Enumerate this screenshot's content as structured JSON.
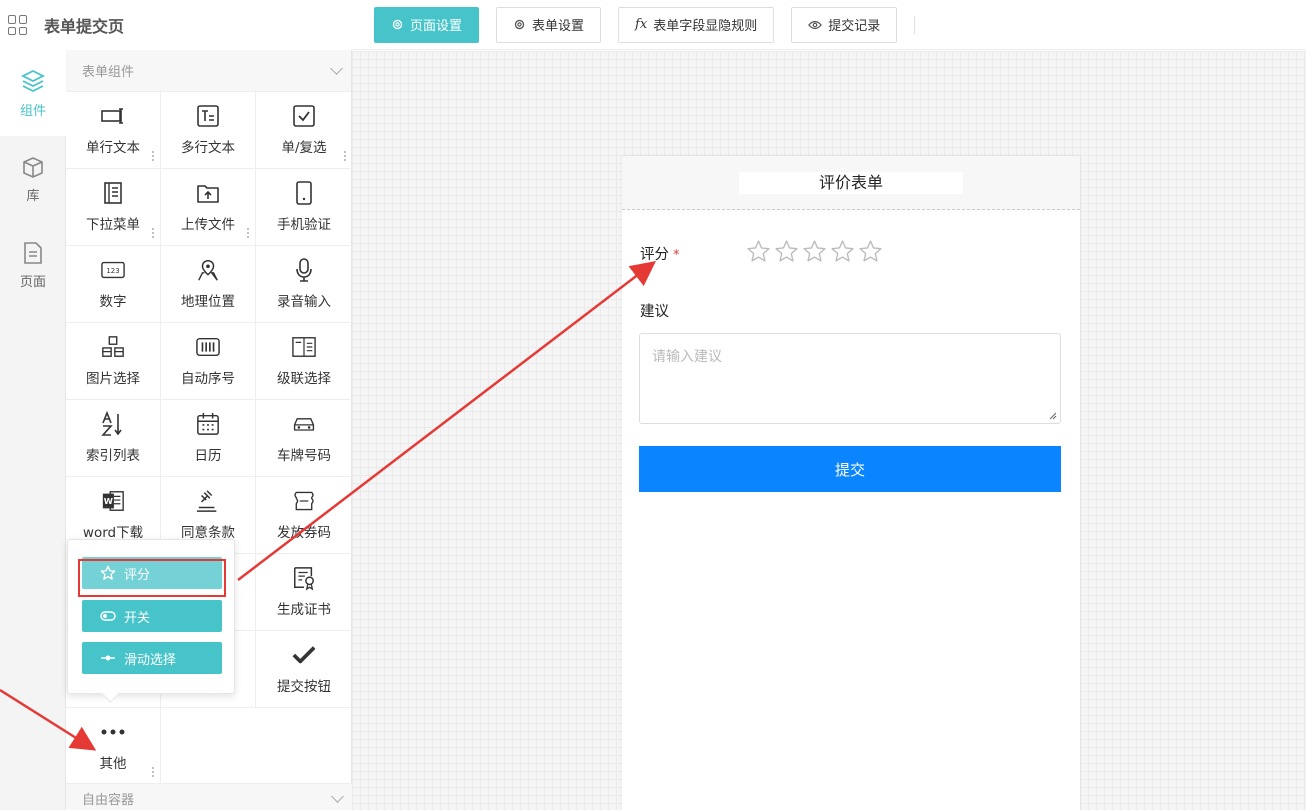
{
  "header": {
    "title": "表单提交页"
  },
  "toolbar": {
    "buttons": [
      {
        "label": "页面设置",
        "icon": "gear-icon",
        "active": true
      },
      {
        "label": "表单设置",
        "icon": "gear-icon",
        "active": false
      },
      {
        "label": "表单字段显隐规则",
        "icon": "fx-icon",
        "prefix": "fx",
        "active": false
      },
      {
        "label": "提交记录",
        "icon": "eye-icon",
        "active": false
      }
    ]
  },
  "rail": {
    "items": [
      {
        "label": "组件",
        "icon": "layers-icon",
        "active": true
      },
      {
        "label": "库",
        "icon": "box-icon",
        "active": false
      },
      {
        "label": "页面",
        "icon": "page-icon",
        "active": false
      }
    ]
  },
  "panel": {
    "section_title": "表单组件",
    "footer_title": "自由容器",
    "components": [
      {
        "label": "单行文本",
        "icon": "text-input-icon"
      },
      {
        "label": "多行文本",
        "icon": "textarea-icon"
      },
      {
        "label": "单/复选",
        "icon": "checkbox-icon"
      },
      {
        "label": "下拉菜单",
        "icon": "dropdown-icon"
      },
      {
        "label": "上传文件",
        "icon": "upload-icon"
      },
      {
        "label": "手机验证",
        "icon": "phone-icon"
      },
      {
        "label": "数字",
        "icon": "number-icon",
        "glyph": "123"
      },
      {
        "label": "地理位置",
        "icon": "map-pin-icon"
      },
      {
        "label": "录音输入",
        "icon": "microphone-icon"
      },
      {
        "label": "图片选择",
        "icon": "image-select-icon"
      },
      {
        "label": "自动序号",
        "icon": "barcode-icon"
      },
      {
        "label": "级联选择",
        "icon": "cascade-icon"
      },
      {
        "label": "索引列表",
        "icon": "sort-az-icon"
      },
      {
        "label": "日历",
        "icon": "calendar-icon"
      },
      {
        "label": "车牌号码",
        "icon": "car-icon"
      },
      {
        "label": "word下载",
        "icon": "word-icon"
      },
      {
        "label": "同意条款",
        "icon": "gavel-icon"
      },
      {
        "label": "发放券码",
        "icon": "coupon-icon"
      },
      {
        "label": "",
        "icon": "hidden-icon"
      },
      {
        "label": "",
        "icon": "hidden-icon"
      },
      {
        "label": "生成证书",
        "icon": "certificate-icon"
      },
      {
        "label": "",
        "icon": "hidden-icon"
      },
      {
        "label": "",
        "icon": "hidden-icon"
      },
      {
        "label": "提交按钮",
        "icon": "check-icon"
      }
    ],
    "other": {
      "label": "其他",
      "icon": "more-icon"
    }
  },
  "popover": {
    "items": [
      {
        "label": "评分",
        "icon": "star-icon"
      },
      {
        "label": "开关",
        "icon": "toggle-icon"
      },
      {
        "label": "滑动选择",
        "icon": "slider-icon"
      }
    ]
  },
  "form": {
    "title": "评价表单",
    "rating_label": "评分",
    "required_mark": "*",
    "rating": {
      "value": 0,
      "max": 5
    },
    "suggestion_label": "建议",
    "suggestion_placeholder": "请输入建议",
    "submit_label": "提交"
  },
  "colors": {
    "accent": "#47c4c9",
    "submit": "#0a84ff",
    "annotation": "#e53935"
  }
}
